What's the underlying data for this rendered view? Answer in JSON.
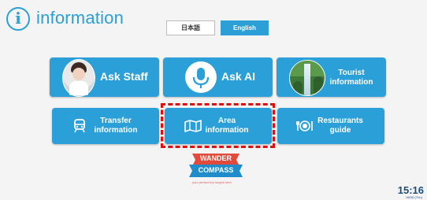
{
  "header": {
    "icon": "info-icon",
    "title": "information"
  },
  "language": {
    "japanese_label": "日本語",
    "english_label": "English",
    "selected": "English"
  },
  "tiles": {
    "ask_staff": {
      "label": "Ask Staff",
      "icon": "staff-photo"
    },
    "ask_ai": {
      "label": "Ask AI",
      "icon": "microphone-icon"
    },
    "tourist": {
      "line1": "Tourist",
      "line2": "information",
      "icon": "waterfall-photo"
    },
    "transfer": {
      "line1": "Transfer",
      "line2": "information",
      "icon": "train-icon"
    },
    "area": {
      "line1": "Area",
      "line2": "information",
      "icon": "map-icon"
    },
    "restaurants": {
      "line1": "Restaurants",
      "line2": "guide",
      "icon": "dining-icon"
    }
  },
  "highlight_color": "#e01010",
  "accent_color": "#2ba0d8",
  "logo": {
    "line1": "WANDER",
    "line2": "COMPASS",
    "tagline": "your perfect trip begins here"
  },
  "clock": {
    "time": "15:16",
    "date": "08/30 (Thu)"
  }
}
